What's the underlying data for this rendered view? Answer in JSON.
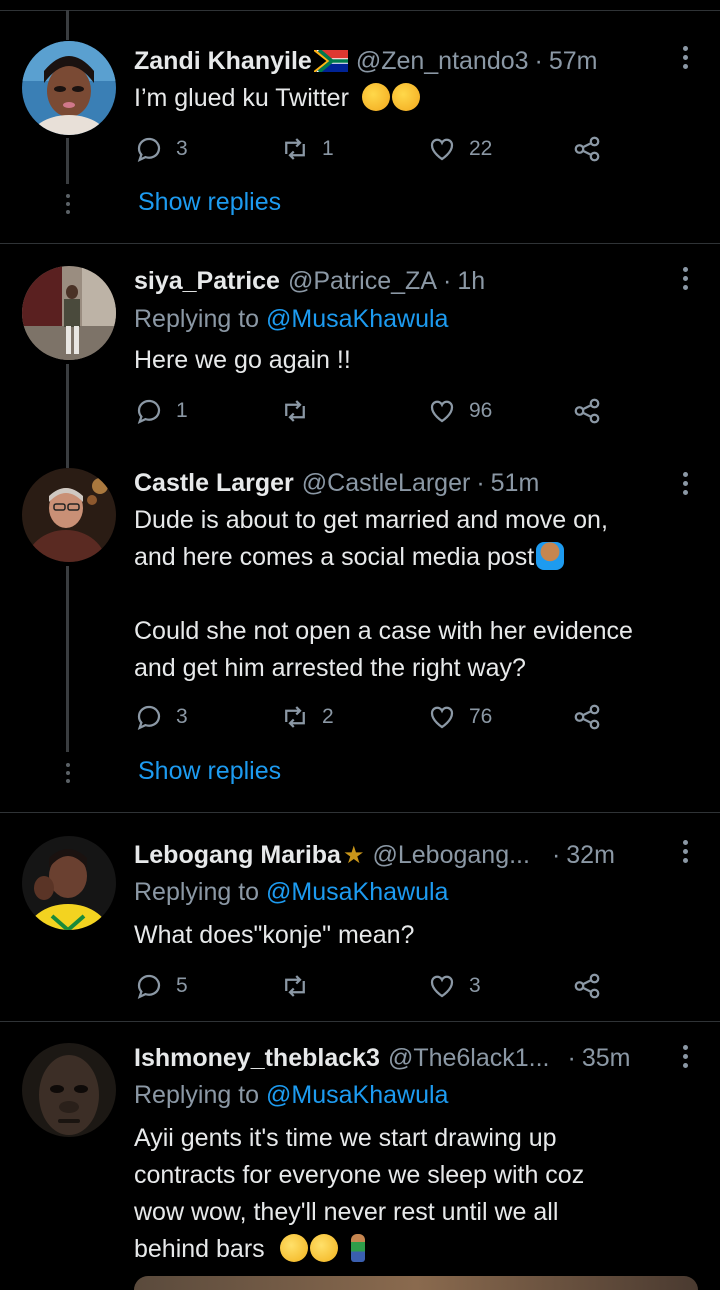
{
  "tweets": [
    {
      "name": "Zandi Khanyile",
      "handle": "@Zen_ntando3",
      "time": "57m",
      "text": "I’m glued ku Twitter",
      "replies": "3",
      "retweets": "1",
      "likes": "22",
      "show_replies": "Show replies"
    },
    {
      "name": "siya_Patrice",
      "handle": "@Patrice_ZA",
      "time": "1h",
      "replying_prefix": "Replying to",
      "replying_to": "@MusaKhawula",
      "text": "Here we go again !!",
      "replies": "1",
      "retweets": "",
      "likes": "96"
    },
    {
      "name": "Castle Larger",
      "handle": "@CastleLarger",
      "time": "51m",
      "text_line1": "Dude is about to get married and move on,",
      "text_line2": "and here comes a social media post",
      "text_line3": "Could she not open a case with her evidence",
      "text_line4": "and get him arrested the right way?",
      "replies": "3",
      "retweets": "2",
      "likes": "76",
      "show_replies": "Show replies"
    },
    {
      "name": "Lebogang Mariba",
      "handle": "@Lebogang...",
      "time": "32m",
      "replying_prefix": "Replying to",
      "replying_to": "@MusaKhawula",
      "text": "What does\"konje\" mean?",
      "replies": "5",
      "retweets": "",
      "likes": "3"
    },
    {
      "name": "Ishmoney_theblack3",
      "handle": "@The6lack1...",
      "time": "35m",
      "replying_prefix": "Replying to",
      "replying_to": "@MusaKhawula",
      "text_line1": "Ayii gents it's time we start drawing up",
      "text_line2": "contracts for everyone we sleep with coz",
      "text_line3": "wow wow, they'll never rest until we all",
      "text_line4": "behind bars"
    }
  ],
  "colors": {
    "accent": "#1d9bf0",
    "muted": "#8b98a5",
    "background": "#000000"
  }
}
